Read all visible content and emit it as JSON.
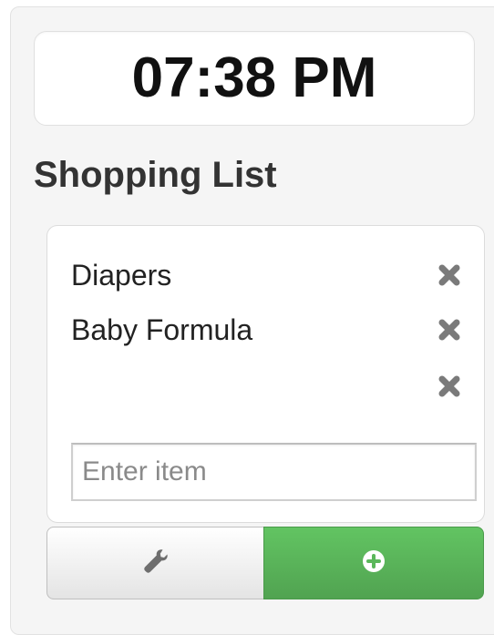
{
  "clock": {
    "time": "07:38 PM"
  },
  "shopping_list": {
    "title": "Shopping List",
    "items": [
      {
        "label": "Diapers",
        "remove_icon": "remove-x-icon"
      },
      {
        "label": "Baby Formula",
        "remove_icon": "remove-x-icon"
      },
      {
        "label": "",
        "remove_icon": "remove-x-icon"
      }
    ],
    "input": {
      "value": "",
      "placeholder": "Enter item"
    }
  },
  "actions": {
    "settings_icon": "wrench-icon",
    "add_icon": "plus-circle-icon"
  },
  "colors": {
    "accent_green": "#5bb75b",
    "icon_gray": "#7a7a7a",
    "title_text": "#333333"
  }
}
